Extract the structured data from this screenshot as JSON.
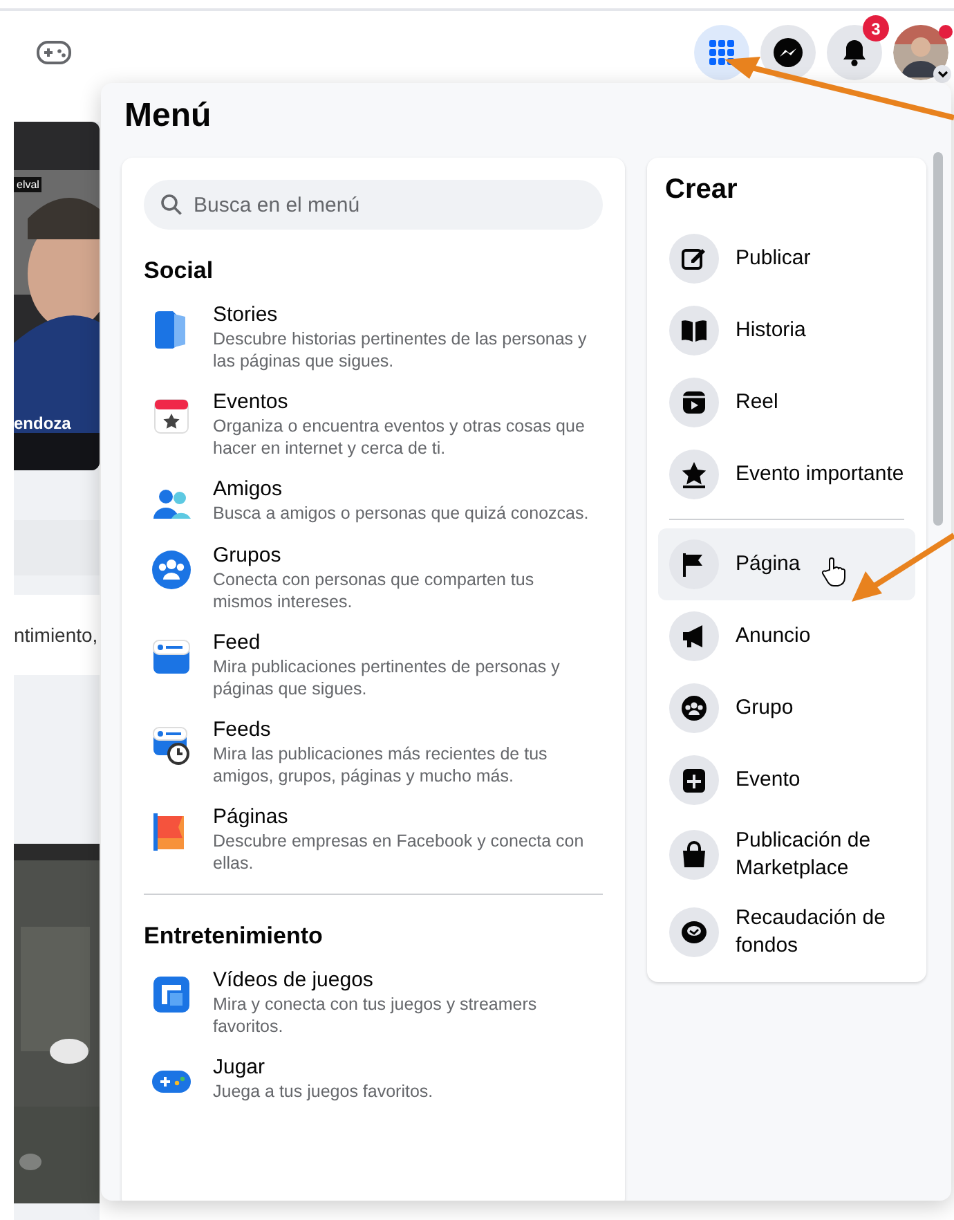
{
  "top_bar": {
    "buttons": [
      {
        "kind": "apps",
        "selected": true
      },
      {
        "kind": "messenger",
        "selected": false
      },
      {
        "kind": "bell",
        "selected": false,
        "badge": "3"
      },
      {
        "kind": "avatar"
      }
    ]
  },
  "background": {
    "story_tag": "elval",
    "story_name": "endoza",
    "post_text": "ntimiento,"
  },
  "menu": {
    "title": "Menú",
    "search": {
      "placeholder": "Busca en el menú"
    },
    "sections": [
      {
        "title": "Social",
        "items": [
          {
            "kind": "stories",
            "title": "Stories",
            "description": "Descubre historias pertinentes de las personas y las páginas que sigues."
          },
          {
            "kind": "events",
            "title": "Eventos",
            "description": "Organiza o encuentra eventos y otras cosas que hacer en internet y cerca de ti."
          },
          {
            "kind": "friends",
            "title": "Amigos",
            "description": "Busca a amigos o personas que quizá conozcas."
          },
          {
            "kind": "groups",
            "title": "Grupos",
            "description": "Conecta con personas que comparten tus mismos intereses."
          },
          {
            "kind": "feed",
            "title": "Feed",
            "description": "Mira publicaciones pertinentes de personas y páginas que sigues."
          },
          {
            "kind": "feeds",
            "title": "Feeds",
            "description": "Mira las publicaciones más recientes de tus amigos, grupos, páginas y mucho más."
          },
          {
            "kind": "pages",
            "title": "Páginas",
            "description": "Descubre empresas en Facebook y conecta con ellas."
          }
        ]
      },
      {
        "title": "Entretenimiento",
        "items": [
          {
            "kind": "gamevideo",
            "title": "Vídeos de juegos",
            "description": "Mira y conecta con tus juegos y streamers favoritos."
          },
          {
            "kind": "play",
            "title": "Jugar",
            "description": "Juega a tus juegos favoritos."
          }
        ]
      }
    ],
    "create": {
      "title": "Crear",
      "groups": [
        [
          {
            "kind": "edit",
            "label": "Publicar",
            "hovered": false
          },
          {
            "kind": "book",
            "label": "Historia",
            "hovered": false
          },
          {
            "kind": "reel",
            "label": "Reel",
            "hovered": false
          },
          {
            "kind": "star",
            "label": "Evento importante",
            "hovered": false
          }
        ],
        [
          {
            "kind": "flag",
            "label": "Página",
            "hovered": true
          },
          {
            "kind": "megaphone",
            "label": "Anuncio",
            "hovered": false
          },
          {
            "kind": "group",
            "label": "Grupo",
            "hovered": false
          },
          {
            "kind": "plus",
            "label": "Evento",
            "hovered": false
          },
          {
            "kind": "bag",
            "label": "Publicación de Marketplace",
            "hovered": false
          },
          {
            "kind": "coin",
            "label": "Recaudación de fondos",
            "hovered": false
          }
        ]
      ]
    }
  }
}
